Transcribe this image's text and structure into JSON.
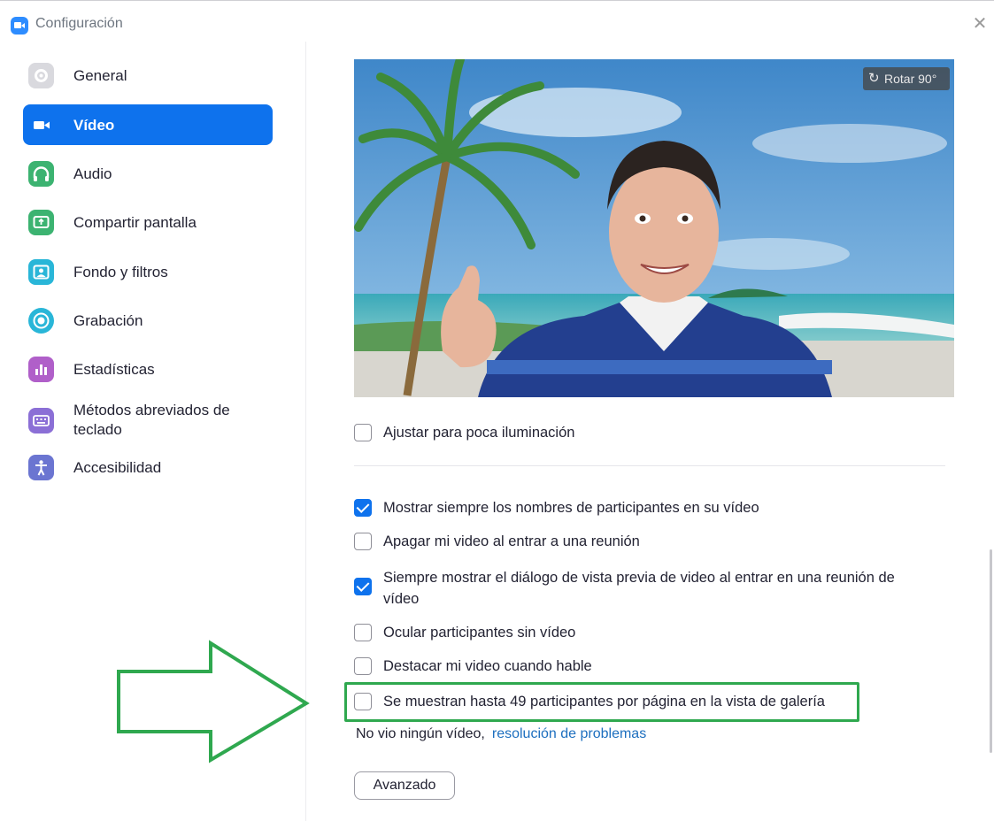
{
  "window": {
    "title": "Configuración"
  },
  "sidebar": {
    "items": [
      {
        "label": "General",
        "icon": "gear-icon",
        "color": "#d9d9de",
        "active": false
      },
      {
        "label": "Vídeo",
        "icon": "video-camera-icon",
        "color": "#0e72ed",
        "active": true
      },
      {
        "label": "Audio",
        "icon": "headphones-icon",
        "color": "#3cb371",
        "active": false
      },
      {
        "label": "Compartir pantalla",
        "icon": "share-screen-icon",
        "color": "#3cb371",
        "active": false
      },
      {
        "label": "Fondo y filtros",
        "icon": "background-filters-icon",
        "color": "#29b6d8",
        "active": false
      },
      {
        "label": "Grabación",
        "icon": "recording-icon",
        "color": "#29b6d8",
        "active": false
      },
      {
        "label": "Estadísticas",
        "icon": "statistics-icon",
        "color": "#b05fc9",
        "active": false
      },
      {
        "label": "Métodos abreviados de teclado",
        "icon": "keyboard-icon",
        "color": "#8b6fd6",
        "active": false
      },
      {
        "label": "Accesibilidad",
        "icon": "accessibility-icon",
        "color": "#6b75d1",
        "active": false
      }
    ]
  },
  "preview": {
    "rotate_label": "Rotar 90°"
  },
  "options": {
    "low_light": {
      "label": "Ajustar para poca iluminación",
      "checked": false
    },
    "show_names": {
      "label": "Mostrar siempre los nombres de participantes en su vídeo",
      "checked": true
    },
    "video_off": {
      "label": "Apagar mi video al entrar a una reunión",
      "checked": false
    },
    "preview_dialog": {
      "label": "Siempre mostrar el diálogo de vista previa de video al entrar en una reunión de vídeo",
      "checked": true
    },
    "hide_no_video": {
      "label": "Ocular participantes sin vídeo",
      "checked": false
    },
    "spotlight": {
      "label": "Destacar mi video cuando hable",
      "checked": false
    },
    "gallery_49": {
      "label": "Se muestran hasta 49 participantes por página en la vista de galería",
      "checked": false
    }
  },
  "trouble": {
    "text": "No vio ningún vídeo,",
    "link": "resolución de problemas"
  },
  "advanced_button": "Avanzado",
  "colors": {
    "accent": "#0e72ed",
    "highlight": "#2fa84f",
    "link": "#1d6fbf"
  }
}
